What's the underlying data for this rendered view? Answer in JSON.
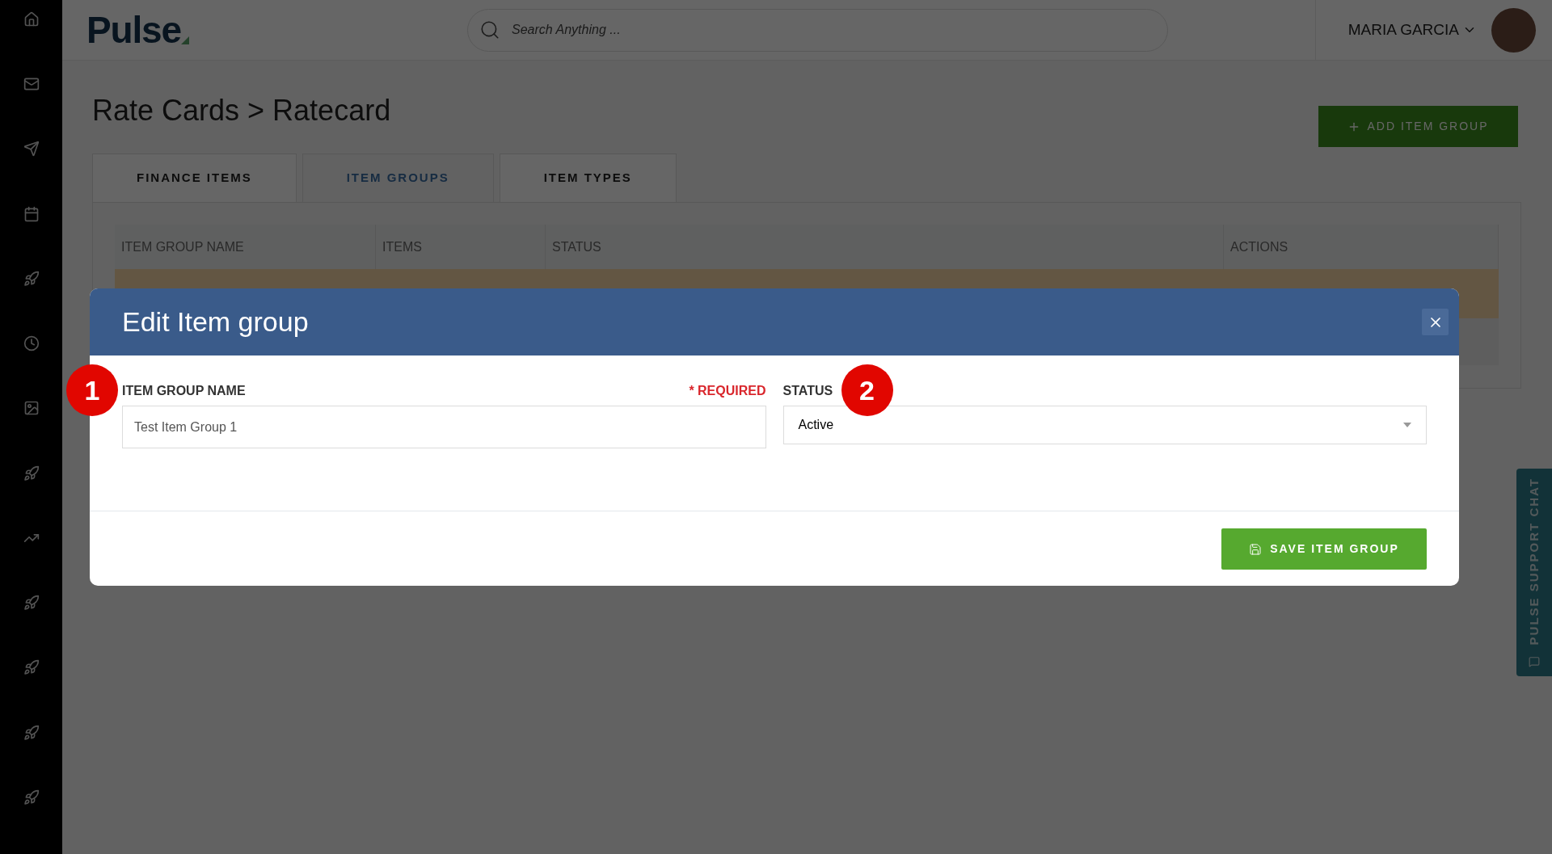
{
  "topbar": {
    "logo": "Pulse",
    "search": {
      "placeholder": "Search Anything ..."
    },
    "user": "MARIA GARCIA"
  },
  "page": {
    "title": "Rate Cards > Ratecard",
    "add_button": "ADD ITEM GROUP",
    "tabs": [
      {
        "label": "FINANCE ITEMS",
        "selected": false
      },
      {
        "label": "ITEM GROUPS",
        "selected": true
      },
      {
        "label": "ITEM TYPES",
        "selected": false
      }
    ],
    "table": {
      "columns": [
        "ITEM GROUP NAME",
        "ITEMS",
        "STATUS",
        "ACTIONS"
      ]
    }
  },
  "modal": {
    "title": "Edit Item group",
    "fields": [
      {
        "kind": "text",
        "label": "ITEM GROUP NAME",
        "required": "* REQUIRED",
        "value": "Test Item Group 1",
        "marker": "1"
      },
      {
        "kind": "select",
        "label": "STATUS",
        "value": "Active",
        "marker": "2"
      }
    ],
    "save_button": "SAVE ITEM GROUP"
  },
  "support_chat": "PULSE SUPPORT CHAT"
}
